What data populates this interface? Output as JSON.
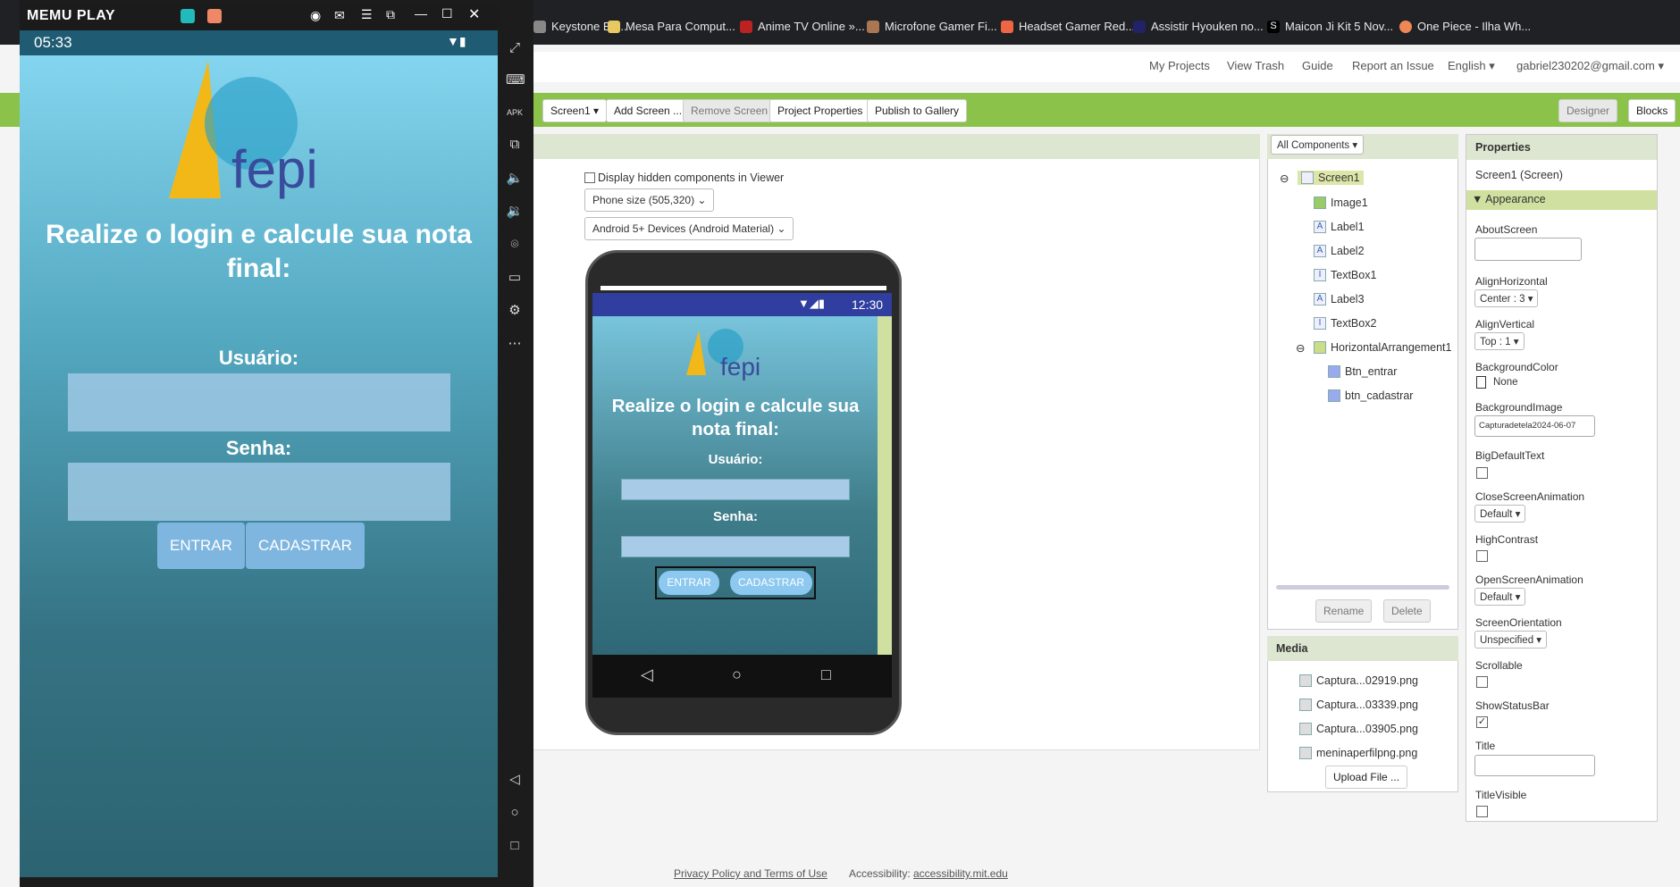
{
  "bookmarks": [
    {
      "label": "Keystone Ba..."
    },
    {
      "label": "Mesa Para Comput..."
    },
    {
      "label": "Anime TV Online »..."
    },
    {
      "label": "Microfone Gamer Fi..."
    },
    {
      "label": "Headset Gamer Red..."
    },
    {
      "label": "Assistir Hyouken no..."
    },
    {
      "label": "Maicon Ji Kit 5 Nov..."
    },
    {
      "label": "One Piece - Ilha Wh..."
    }
  ],
  "topnav": {
    "my_projects": "My Projects",
    "view_trash": "View Trash",
    "guide": "Guide",
    "report": "Report an Issue",
    "language": "English ▾",
    "account": "gabriel230202@gmail.com ▾"
  },
  "toolbar": {
    "screen": "Screen1 ▾",
    "add_screen": "Add Screen ...",
    "remove_screen": "Remove Screen",
    "project_properties": "Project Properties",
    "publish": "Publish to Gallery",
    "designer": "Designer",
    "blocks": "Blocks"
  },
  "viewer": {
    "hidden_label": "Display hidden components in Viewer",
    "phone_size": "Phone size (505,320)",
    "device_theme": "Android 5+ Devices (Android Material)"
  },
  "phone": {
    "time": "12:30",
    "logo": "fepi",
    "title": "Realize o login e calcule sua nota final:",
    "user_label": "Usuário:",
    "pass_label": "Senha:",
    "btn_enter": "ENTRAR",
    "btn_register": "CADASTRAR"
  },
  "components": {
    "header": "All Components ▾",
    "items": [
      {
        "label": "Screen1"
      },
      {
        "label": "Image1"
      },
      {
        "label": "Label1"
      },
      {
        "label": "Label2"
      },
      {
        "label": "TextBox1"
      },
      {
        "label": "Label3"
      },
      {
        "label": "TextBox2"
      },
      {
        "label": "HorizontalArrangement1"
      },
      {
        "label": "Btn_entrar"
      },
      {
        "label": "btn_cadastrar"
      }
    ],
    "rename": "Rename",
    "delete": "Delete"
  },
  "media": {
    "header": "Media",
    "files": [
      {
        "label": "Captura...02919.png"
      },
      {
        "label": "Captura...03339.png"
      },
      {
        "label": "Captura...03905.png"
      },
      {
        "label": "meninaperfilpng.png"
      }
    ],
    "upload": "Upload File ..."
  },
  "properties": {
    "header": "Properties",
    "subject": "Screen1 (Screen)",
    "section": "Appearance",
    "about": "AboutScreen",
    "align_h": "AlignHorizontal",
    "align_h_val": "Center : 3 ▾",
    "align_v": "AlignVertical",
    "align_v_val": "Top : 1 ▾",
    "bg_color": "BackgroundColor",
    "bg_color_val": "None",
    "bg_image": "BackgroundImage",
    "bg_image_val": "Capturadetela2024-06-07",
    "big_text": "BigDefaultText",
    "close_anim": "CloseScreenAnimation",
    "close_anim_val": "Default ▾",
    "high_contrast": "HighContrast",
    "open_anim": "OpenScreenAnimation",
    "open_anim_val": "Default ▾",
    "orientation": "ScreenOrientation",
    "orientation_val": "Unspecified ▾",
    "scrollable": "Scrollable",
    "status_bar": "ShowStatusBar",
    "title": "Title",
    "title_visible": "TitleVisible"
  },
  "memu": {
    "brand": "MEMU PLAY",
    "time": "05:33",
    "logo": "fepi",
    "title": "Realize o login e calcule sua nota final:",
    "user_label": "Usuário:",
    "pass_label": "Senha:",
    "btn_enter": "ENTRAR",
    "btn_register": "CADASTRAR"
  },
  "footer": {
    "privacy": "Privacy Policy and Terms of Use",
    "access_label": "Accessibility:",
    "access_link": "accessibility.mit.edu"
  }
}
